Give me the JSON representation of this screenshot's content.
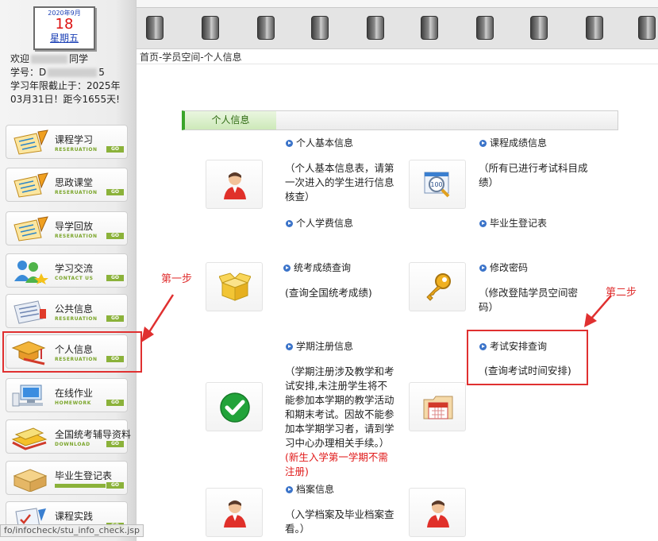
{
  "calendar": {
    "year_month": "2020年9月",
    "day": "18",
    "weekday": "星期五"
  },
  "welcome": {
    "greeting_prefix": "欢迎",
    "greeting_suffix": "同学",
    "student_id_prefix": "学号：D",
    "student_id_suffix": "5",
    "validity": "学习年限截止于：2025年03月31日！距今1655天!"
  },
  "sidebar": {
    "items": [
      {
        "label": "课程学习",
        "sub": "RESERUATION",
        "go": "GO"
      },
      {
        "label": "思政课堂",
        "sub": "RESERUATION",
        "go": "GO"
      },
      {
        "label": "导学回放",
        "sub": "RESERUATION",
        "go": "GO"
      },
      {
        "label": "学习交流",
        "sub": "CONTACT US",
        "go": "GO"
      },
      {
        "label": "公共信息",
        "sub": "RESERUATION",
        "go": "GO"
      },
      {
        "label": "个人信息",
        "sub": "RESERUATION",
        "go": "GO"
      },
      {
        "label": "在线作业",
        "sub": "HOMEWORK",
        "go": "GO"
      },
      {
        "label": "全国统考辅导资料",
        "sub": "DOWNLOAD",
        "go": "GO"
      },
      {
        "label": "毕业生登记表",
        "sub": "",
        "go": "GO"
      },
      {
        "label": "课程实践",
        "sub": "",
        "go": "GO"
      }
    ]
  },
  "status_url": "fo/infocheck/stu_info_check.jsp",
  "breadcrumb": "首页-学员空间-个人信息",
  "section": {
    "title": "个人信息"
  },
  "cards": {
    "basic_info": {
      "title": "个人基本信息",
      "desc": "（个人基本信息表，请第一次进入的学生进行信息核查）"
    },
    "grades": {
      "title": "课程成绩信息",
      "desc": "（所有已进行考试科目成绩）"
    },
    "tuition": {
      "title": "个人学费信息"
    },
    "graduate_form": {
      "title": "毕业生登记表"
    },
    "unified_exam": {
      "title": "统考成绩查询",
      "desc": "(查询全国统考成绩)"
    },
    "password": {
      "title": "修改密码",
      "desc": "（修改登陆学员空间密码）"
    },
    "registration": {
      "title": "学期注册信息",
      "desc": "（学期注册涉及教学和考试安排,未注册学生将不能参加本学期的教学活动和期末考试。因故不能参加本学期学习者，请到学习中心办理相关手续。）",
      "note": "(新生入学第一学期不需注册)"
    },
    "exam_schedule": {
      "title": "考试安排查询",
      "desc": "(查询考试时间安排)"
    },
    "archive": {
      "title": "档案信息",
      "desc": "（入学档案及毕业档案查看。）"
    }
  },
  "annotations": {
    "step1": "第一步",
    "step2": "第二步"
  },
  "colors": {
    "accent_green": "#3aa52a",
    "highlight_red": "#e03030",
    "link_blue": "#3a73c9"
  }
}
